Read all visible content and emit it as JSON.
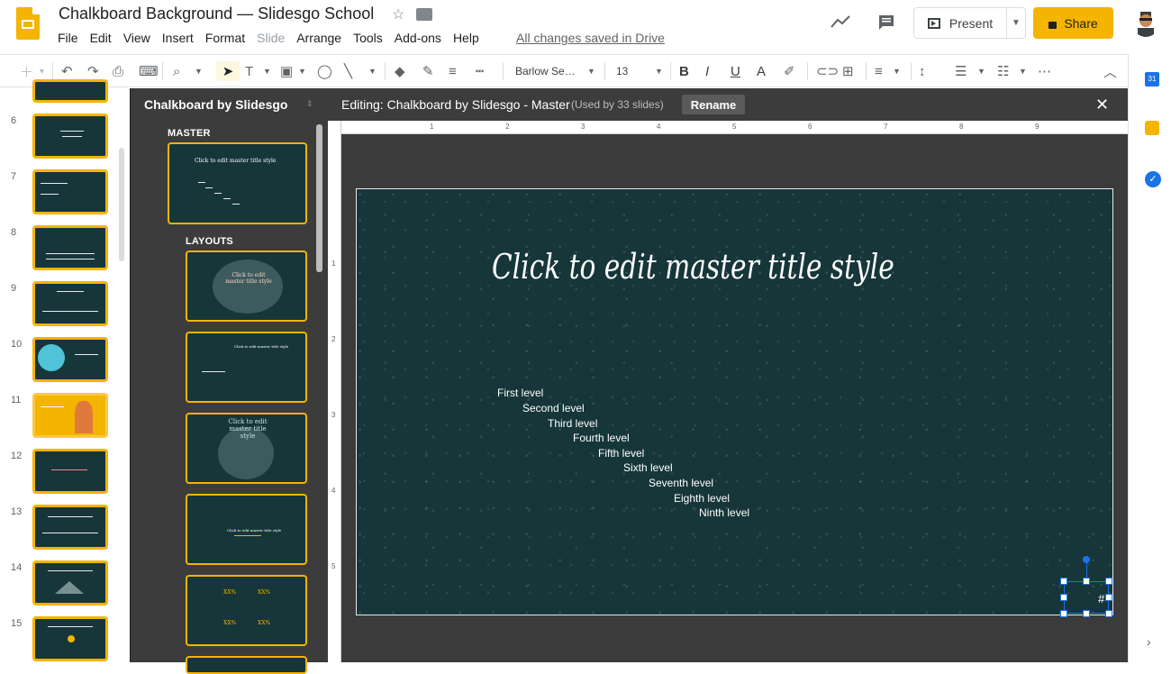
{
  "document": {
    "title": "Chalkboard Background — Slidesgo School"
  },
  "menu": [
    "File",
    "Edit",
    "View",
    "Insert",
    "Format",
    "Slide",
    "Arrange",
    "Tools",
    "Add-ons",
    "Help"
  ],
  "menu_disabled": [
    "Slide"
  ],
  "status": {
    "saved": "All changes saved in Drive"
  },
  "header": {
    "present_label": "Present",
    "share_label": "Share"
  },
  "toolbar": {
    "font_name": "Barlow Se…",
    "font_size": "13"
  },
  "filmstrip": {
    "slides": [
      "6",
      "7",
      "8",
      "9",
      "10",
      "11",
      "12",
      "13",
      "14",
      "15"
    ]
  },
  "master_panel": {
    "title": "Chalkboard by Slidesgo",
    "master_label": "MASTER",
    "layouts_label": "LAYOUTS",
    "master_thumb_title": "Click to edit master title style",
    "layout_thumbs": [
      "Click to edit master title style",
      "Click to edit master title style",
      "Click to edit master title style",
      "Click to edit master title style",
      "XX%"
    ]
  },
  "editor": {
    "editing_label": "Editing: Chalkboard by Slidesgo - Master",
    "used_by": "(Used by 33 slides)",
    "rename_label": "Rename",
    "close_glyph": "✕"
  },
  "rulers": {
    "horizontal": [
      "1",
      "2",
      "3",
      "4",
      "5",
      "6",
      "7",
      "8",
      "9"
    ],
    "vertical": [
      "1",
      "2",
      "3",
      "4",
      "5"
    ]
  },
  "slide": {
    "title": "Click to edit master title style",
    "levels": [
      "First level",
      "Second level",
      "Third level",
      "Fourth level",
      "Fifth level",
      "Sixth level",
      "Seventh level",
      "Eighth level",
      "Ninth level"
    ],
    "slide_number_mark": "#"
  },
  "colors": {
    "accent": "#f4b400",
    "slide_bg": "#16363a",
    "panel_bg": "#3c3c3c",
    "selection": "#1a73e8"
  }
}
